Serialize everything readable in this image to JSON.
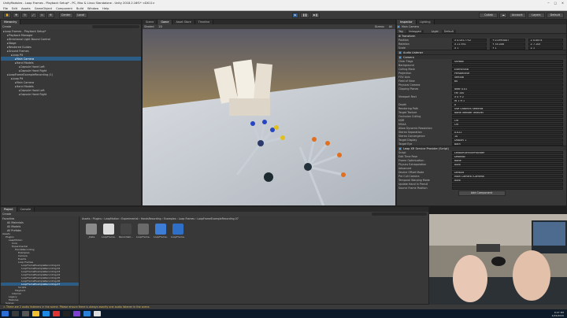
{
  "window": {
    "title": "UnityModules - Loop Frames - Playback Setup* - PC, Mac & Linux Standalone - Unity 2018.2.16f1* <DX11>"
  },
  "menu": [
    "File",
    "Edit",
    "Assets",
    "GameObject",
    "Component",
    "Build",
    "Window",
    "Help"
  ],
  "toolbar": {
    "center": "Center",
    "local": "Local",
    "collab": "Collab",
    "account": "Account",
    "layers": "Layers",
    "layout": "Default"
  },
  "hierarchy": {
    "tab": "Hierarchy",
    "create": "Create",
    "items": [
      {
        "label": "Loop Frames - Playback Setup*",
        "indent": 0
      },
      {
        "label": "Playback Manager",
        "indent": 1
      },
      {
        "label": "Directional Light Bound Control",
        "indent": 1
      },
      {
        "label": "Stage",
        "indent": 1
      },
      {
        "label": "Rendered Guides",
        "indent": 1
      },
      {
        "label": "Ground Frames",
        "indent": 1
      },
      {
        "label": "Loop Pit",
        "indent": 2
      },
      {
        "label": "Main Camera",
        "indent": 3,
        "selected": true
      },
      {
        "label": "Hand Models",
        "indent": 3
      },
      {
        "label": "Capsule Hand Left",
        "indent": 4
      },
      {
        "label": "Capsule Hand Right",
        "indent": 4
      },
      {
        "label": "LoopFrameExampleRecording (1)",
        "indent": 1
      },
      {
        "label": "Loop Pit",
        "indent": 2
      },
      {
        "label": "Main Camera",
        "indent": 3
      },
      {
        "label": "Hand Models",
        "indent": 3
      },
      {
        "label": "Capsule Hand Left",
        "indent": 4
      },
      {
        "label": "Capsule Hand Right",
        "indent": 4
      }
    ]
  },
  "scene": {
    "tabs": [
      "Scene",
      "Game",
      "Asset Store",
      "Timeline"
    ],
    "shading": "Shaded",
    "mode": "2D",
    "gizmos": "Gizmos",
    "search": "All"
  },
  "inspector": {
    "tabs": [
      "Inspector",
      "Lighting"
    ],
    "object_name": "Main Camera",
    "tag_label": "Tag",
    "tag": "Untagged",
    "layer_label": "Layer",
    "layer": "Default",
    "transform": {
      "title": "Transform",
      "rows": [
        {
          "k": "Position",
          "x": "X  0.0517752",
          "y": "Y  0.0993007",
          "z": "Z  0.0874"
        },
        {
          "k": "Rotation",
          "x": "X  21.951",
          "y": "Y  34.008",
          "z": "Z  7.105"
        },
        {
          "k": "Scale",
          "x": "X  1",
          "y": "Y  1",
          "z": "Z  1"
        }
      ]
    },
    "components": [
      {
        "type": "header",
        "label": "Audio Listener"
      },
      {
        "type": "header",
        "label": "Camera"
      },
      {
        "type": "row",
        "k": "Clear Flags",
        "v": "Skybox"
      },
      {
        "type": "row",
        "k": "Background",
        "v": ""
      },
      {
        "type": "row",
        "k": "Culling Mask",
        "v": "Everything"
      },
      {
        "type": "row",
        "k": "Projection",
        "v": "Perspective"
      },
      {
        "type": "row",
        "k": "FOV Axis",
        "v": "Vertical"
      },
      {
        "type": "row",
        "k": "Field of View",
        "v": "60"
      },
      {
        "type": "row",
        "k": "Physical Camera",
        "v": ""
      },
      {
        "type": "row",
        "k": "Clipping Planes",
        "v": "Near  0.01"
      },
      {
        "type": "row",
        "k": "",
        "v": "Far  100"
      },
      {
        "type": "row",
        "k": "Viewport Rect",
        "v": "X 0   Y 0"
      },
      {
        "type": "row",
        "k": "",
        "v": "W 1   H 1"
      },
      {
        "type": "row",
        "k": "Depth",
        "v": "0"
      },
      {
        "type": "row",
        "k": "Rendering Path",
        "v": "Use Graphics Settings"
      },
      {
        "type": "row",
        "k": "Target Texture",
        "v": "None (Render Texture)"
      },
      {
        "type": "row",
        "k": "Occlusion Culling",
        "v": ""
      },
      {
        "type": "row",
        "k": "HDR",
        "v": "Off"
      },
      {
        "type": "row",
        "k": "MSAA",
        "v": "Off"
      },
      {
        "type": "row",
        "k": "Allow Dynamic Resolution",
        "v": ""
      },
      {
        "type": "row",
        "k": "Stereo Separation",
        "v": "0.022"
      },
      {
        "type": "row",
        "k": "Stereo Convergence",
        "v": "10"
      },
      {
        "type": "row",
        "k": "Target Display",
        "v": "Display 1"
      },
      {
        "type": "row",
        "k": "Target Eye",
        "v": "Both"
      },
      {
        "type": "header",
        "label": "Leap XR Service Provider (Script)"
      },
      {
        "type": "row",
        "k": "Script",
        "v": "LeapXRServiceProvider"
      },
      {
        "type": "row",
        "k": "Edit Time Pose",
        "v": "Desktop"
      },
      {
        "type": "row",
        "k": "Frame Optimization",
        "v": "None"
      },
      {
        "type": "row",
        "k": "Physics Extrapolation",
        "v": "Auto"
      },
      {
        "type": "row",
        "k": "Advanced",
        "v": ""
      },
      {
        "type": "row",
        "k": "Device Offset Mode",
        "v": "Default"
      },
      {
        "type": "row",
        "k": "Pre Cull Camera",
        "v": "Main Camera (Camera)"
      },
      {
        "type": "row",
        "k": "Temporal Warping Mode",
        "v": "Auto"
      },
      {
        "type": "row",
        "k": "Update Hand In Prerull",
        "v": ""
      },
      {
        "type": "row",
        "k": "Source Frame Position",
        "v": ""
      }
    ],
    "add_component": "Add Component"
  },
  "project": {
    "tabs": [
      "Project",
      "Console"
    ],
    "create": "Create",
    "favorites": [
      "Favorites",
      "All Materials",
      "All Models",
      "All Prefabs"
    ],
    "tree": [
      "Assets",
      "Plugins",
      "LeapMotion",
      "Core",
      "Experimental",
      "HandsRecording",
      "Examples",
      "Camera",
      "Events",
      "Loop Frames",
      "LoopFrameExampleRecording.01",
      "LoopFrameExampleRecording.02",
      "LoopFrameExampleRecording.03",
      "LoopFrameExampleRecording.04",
      "LoopFrameExampleRecording.05",
      "LoopFrameExampleRecording.06",
      "LoopFrameExampleRecording.07",
      "Scripts",
      "Playback",
      "Internal",
      "Legacy",
      "Modules",
      "Scenes"
    ],
    "breadcrumb": "Assets › Plugins › LeapMotion › Experimental › HandsRecording › Examples › Loop Frames › LoopFrameExampleRecording.07",
    "assets": [
      {
        "label": "_Data",
        "color": "#8a8a8a"
      },
      {
        "label": "LoopFrame...",
        "color": "#dddddd"
      },
      {
        "label": "Recordabl...",
        "color": "#444444"
      },
      {
        "label": "LoopFrame...",
        "color": "#6a6a6a"
      },
      {
        "label": "LoopFrame...",
        "color": "#3d7dd6"
      },
      {
        "label": "LoopFrame...",
        "color": "#2f6fc8"
      }
    ]
  },
  "status": {
    "message": "There are 2 audio listeners in the scene. Please ensure there is always exactly one audio listener in the scene."
  },
  "taskbar": {
    "time": "8:07 PM",
    "date": "4/26/2020"
  }
}
